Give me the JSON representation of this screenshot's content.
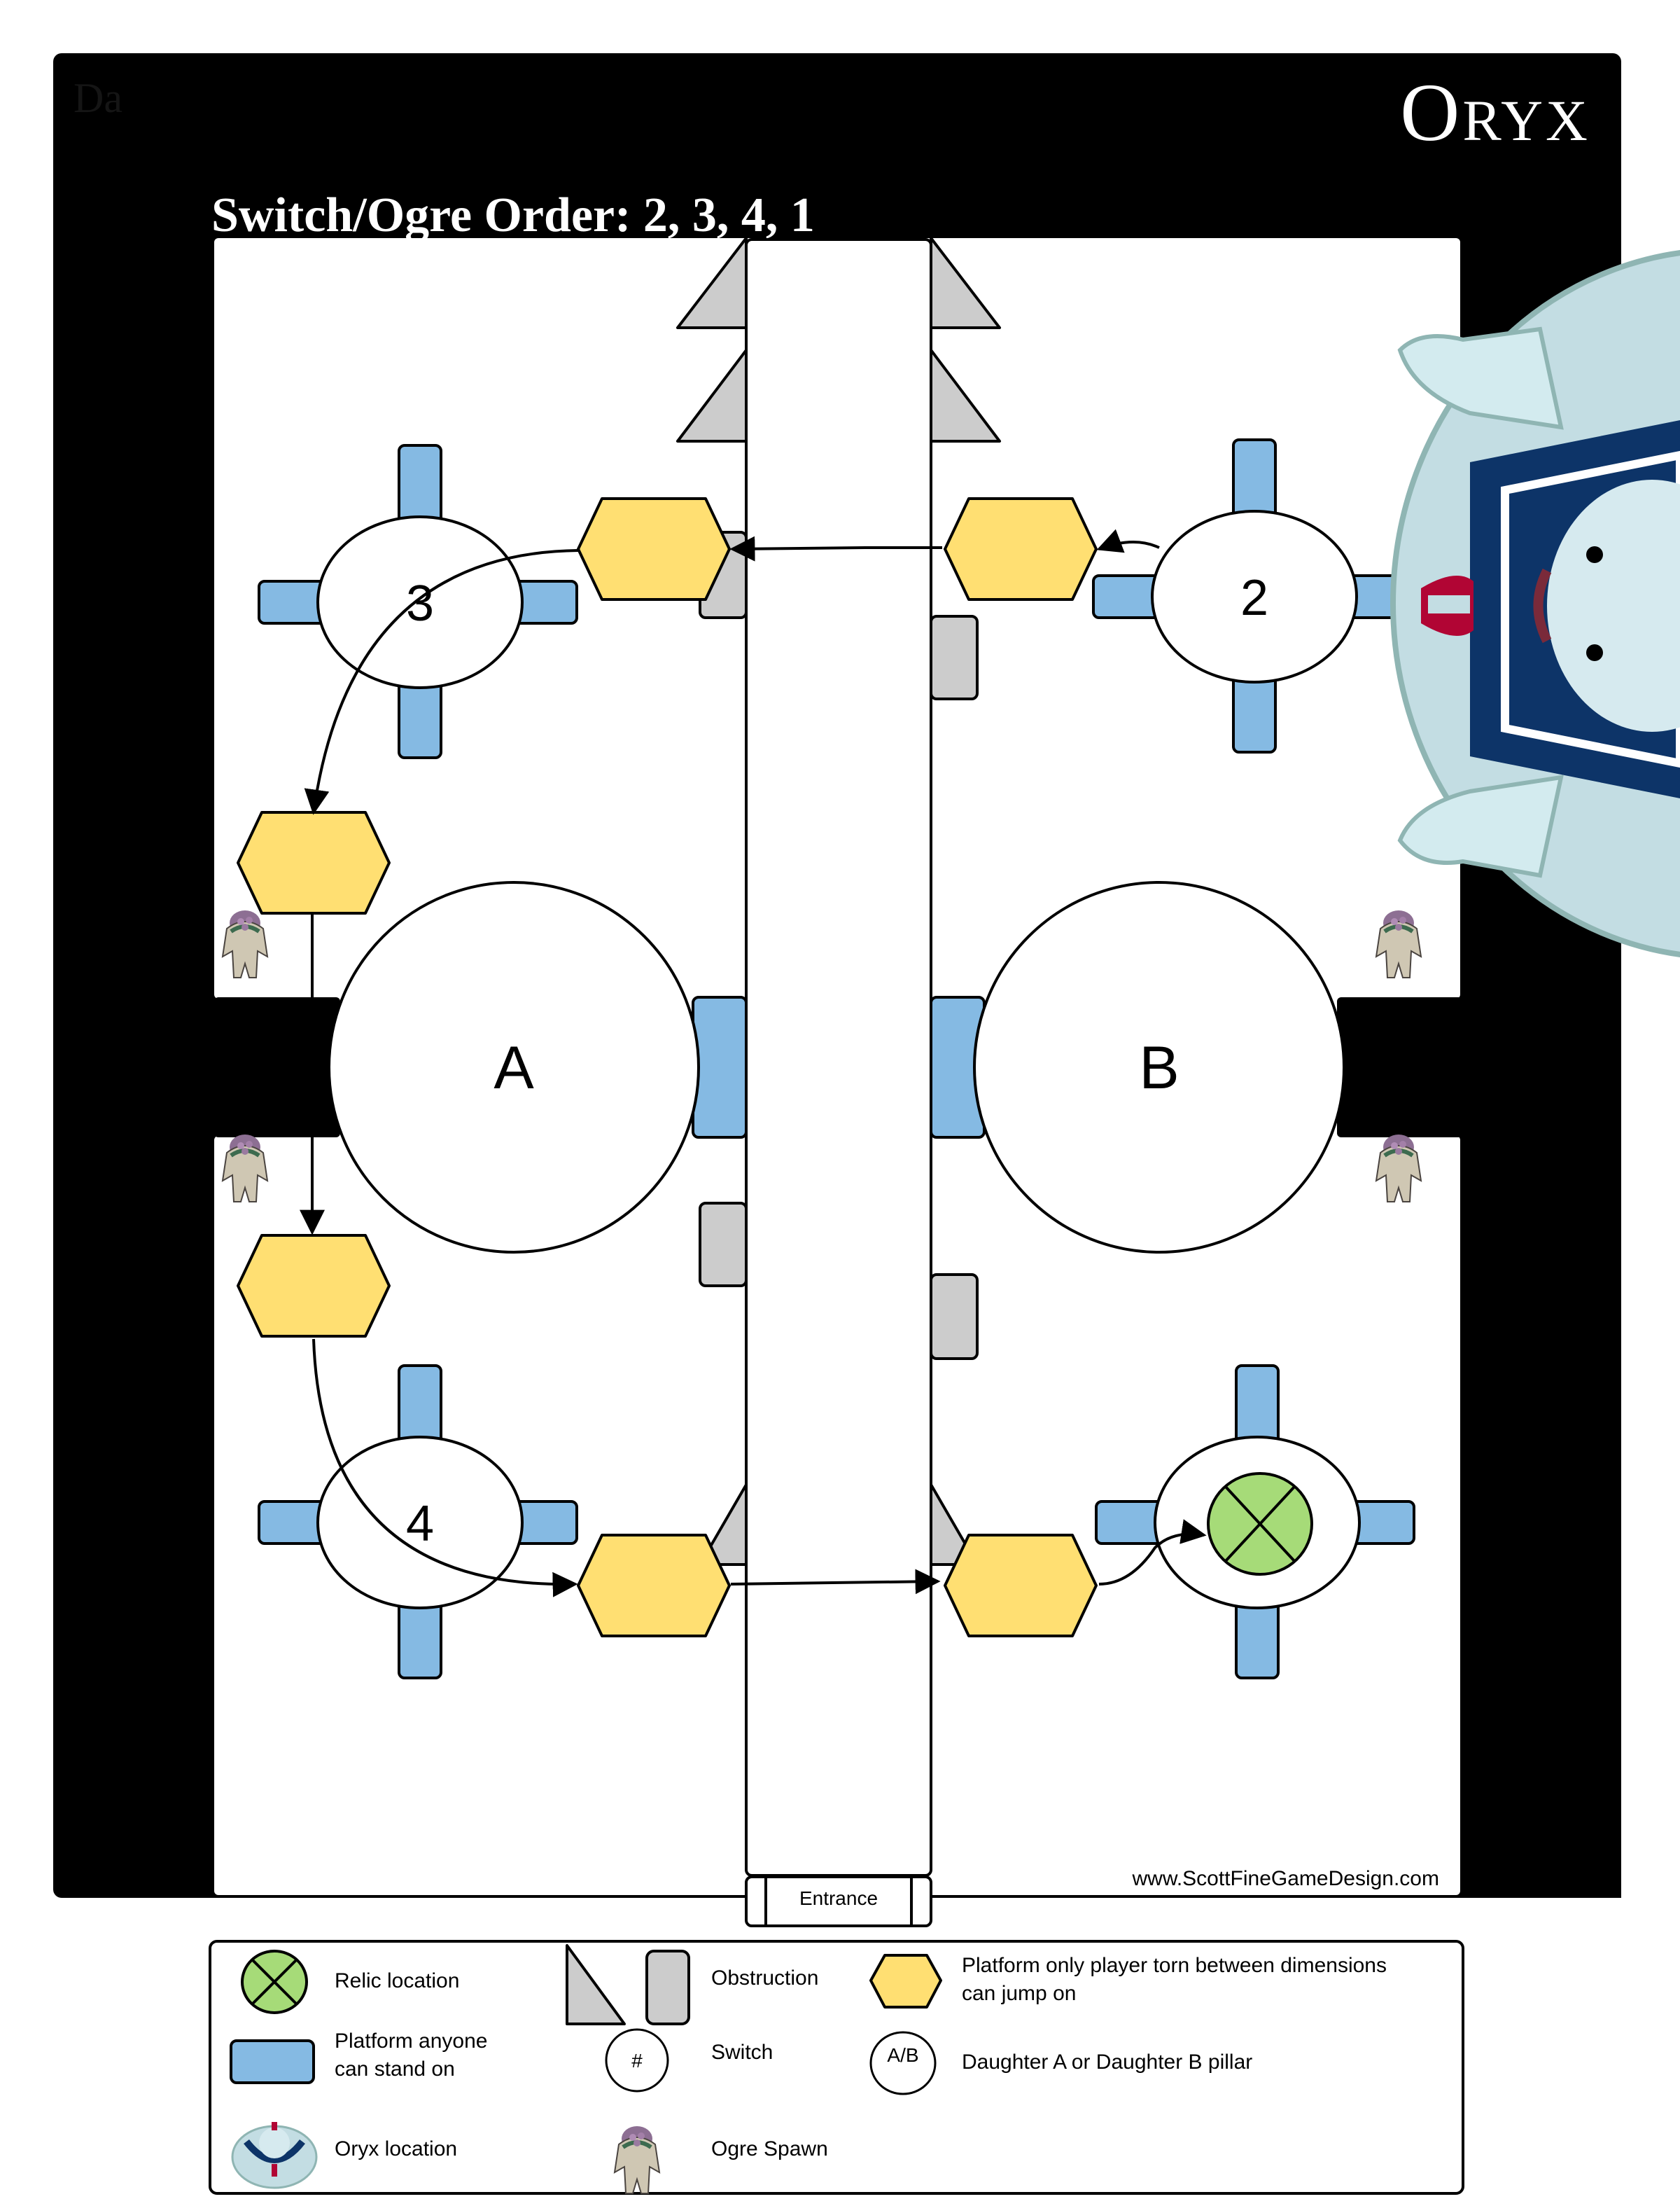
{
  "header": {
    "brand": "Oryx",
    "faint_label": "Da",
    "subtitle": "Switch/Ogre Order: 2, 3, 4, 1"
  },
  "colors": {
    "frame": "#000000",
    "floor": "#ffffff",
    "platform_blue": "#85bae3",
    "platform_yellow": "#ffdf72",
    "obstruction_gray": "#cccccc",
    "relic_green": "#a6db78",
    "stroke": "#000000"
  },
  "map": {
    "entrance_label": "Entrance",
    "credit": "www.ScottFineGameDesign.com",
    "switches": [
      {
        "id": "3",
        "label": "3",
        "side": "left",
        "row": "top"
      },
      {
        "id": "2",
        "label": "2",
        "side": "right",
        "row": "top"
      },
      {
        "id": "4",
        "label": "4",
        "side": "left",
        "row": "bottom"
      },
      {
        "id": "1",
        "label": "",
        "side": "right",
        "row": "bottom",
        "has_relic": true
      }
    ],
    "pillars": [
      {
        "id": "A",
        "label": "A",
        "side": "left"
      },
      {
        "id": "B",
        "label": "B",
        "side": "right"
      }
    ],
    "ogre_spawns": [
      {
        "side": "left",
        "pos": "above-bridge"
      },
      {
        "side": "left",
        "pos": "below-bridge"
      },
      {
        "side": "right",
        "pos": "above-bridge"
      },
      {
        "side": "right",
        "pos": "below-bridge"
      }
    ],
    "route": [
      "switch-2",
      "yellow-top-right",
      "yellow-top-left",
      "yellow-mid-left-top",
      "yellow-mid-left-bottom",
      "yellow-bottom-left",
      "yellow-bottom-right",
      "relic"
    ],
    "oryx_location": "right-wall-top"
  },
  "legend": {
    "items": [
      {
        "key": "relic",
        "label": "Relic location"
      },
      {
        "key": "obstruction",
        "label": "Obstruction"
      },
      {
        "key": "yellow",
        "label": "Platform only player torn between dimensions can jump on",
        "lines": [
          "Platform only player torn between dimensions",
          "can jump on"
        ]
      },
      {
        "key": "blue",
        "label": "Platform anyone can stand on",
        "lines": [
          "Platform anyone",
          "can stand on"
        ]
      },
      {
        "key": "switch",
        "label": "Switch",
        "symbol": "#"
      },
      {
        "key": "pillar",
        "label": "Daughter A or Daughter B pillar",
        "symbol": "A/B"
      },
      {
        "key": "oryx",
        "label": "Oryx location"
      },
      {
        "key": "ogre",
        "label": "Ogre Spawn"
      }
    ]
  }
}
